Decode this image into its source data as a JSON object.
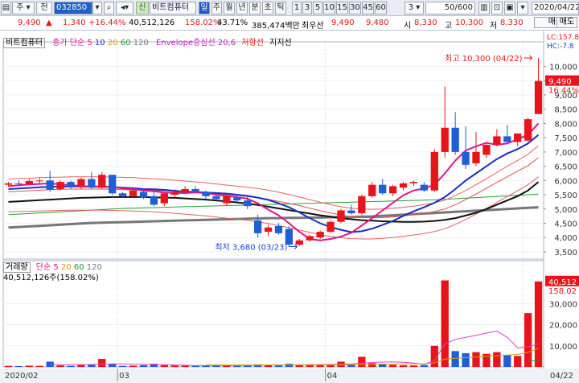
{
  "toolbar": {
    "market": "주",
    "jeon": "전",
    "code": "032850",
    "shin": "신",
    "name": "비트컴퓨터",
    "periods": [
      "일",
      "주",
      "월",
      "년",
      "분",
      "초",
      "틱"
    ],
    "minutes": [
      "1",
      "3",
      "5",
      "10",
      "15",
      "30",
      "45",
      "60"
    ],
    "interval": "3",
    "count": "50",
    "count_total": "/600",
    "date": "2020/04/22"
  },
  "infobar": {
    "price": "9,490",
    "change": "1,340",
    "change_pct": "+16.44%",
    "volume": "40,512,126",
    "vol_ratio": "158.02%",
    "turnover": "43.71%",
    "amount": "385,474백만",
    "best_ask_label": "최우선",
    "best_ask": "9,490",
    "best_bid": "9,480",
    "open_label": "시",
    "open": "8,330",
    "high_label": "고",
    "high": "10,300",
    "low_label": "저",
    "low": "8,330"
  },
  "legend": {
    "name": "비트컴퓨터",
    "ma_label": "종가 단순",
    "ma_periods": [
      "5",
      "10",
      "20",
      "60",
      "120"
    ],
    "envelope": "Envelope중심선 20,6",
    "resistance": "저항선",
    "support": "지지선",
    "lc": "LC:157.8",
    "hc": "HC:-7.8"
  },
  "vol_legend": {
    "label": "거래량",
    "ma_label": "단순",
    "ma_periods": [
      "5",
      "20",
      "60",
      "120"
    ],
    "value": "40,512,126주(158.02%)"
  },
  "annotations": {
    "high": "최고 10,300 (04/22)",
    "low": "최저 3,680 (03/23)",
    "last_price": "9,490",
    "last_pct": "16.44%",
    "last_volume": "40,512",
    "last_vol_pct": "158.02"
  },
  "x_labels": [
    "2020/02",
    "03",
    "04",
    "04/22"
  ],
  "colors": {
    "up": "#e8141c",
    "down": "#1f5fd6",
    "ma5": "#e0148c",
    "ma10": "#1b2fbf",
    "ma20": "#e05050",
    "ma60": "#111111",
    "ma120": "#777777"
  },
  "chart_data": {
    "type": "candlestick",
    "title": "비트컴퓨터",
    "ylim": [
      3300,
      10750
    ],
    "y_ticks": [
      3500,
      4000,
      4500,
      5000,
      5500,
      6000,
      6500,
      7000,
      7500,
      8000,
      8500,
      9000,
      9500,
      10000
    ],
    "y_tick_labels": [
      "3,500",
      "4,000",
      "4,500",
      "5,000",
      "5,500",
      "6,000",
      "6,500",
      "7,000",
      "7,500",
      "8,000",
      "8,500",
      "9,000",
      "9,500",
      "10,000"
    ],
    "vol_ylim": [
      0,
      45000
    ],
    "vol_ticks": [
      10000,
      20000,
      30000
    ],
    "vol_tick_labels": [
      "10,000",
      "20,000",
      "30,000"
    ],
    "candles": [
      {
        "o": 5850,
        "h": 5950,
        "l": 5780,
        "c": 5900,
        "v": 500
      },
      {
        "o": 5900,
        "h": 6000,
        "l": 5820,
        "c": 5880,
        "v": 400
      },
      {
        "o": 5880,
        "h": 6050,
        "l": 5850,
        "c": 5980,
        "v": 600
      },
      {
        "o": 5980,
        "h": 6080,
        "l": 5900,
        "c": 6000,
        "v": 500
      },
      {
        "o": 6000,
        "h": 6350,
        "l": 5600,
        "c": 5680,
        "v": 2500
      },
      {
        "o": 5700,
        "h": 6000,
        "l": 5650,
        "c": 5950,
        "v": 700
      },
      {
        "o": 5950,
        "h": 6000,
        "l": 5700,
        "c": 5800,
        "v": 500
      },
      {
        "o": 5800,
        "h": 6100,
        "l": 5700,
        "c": 6050,
        "v": 900
      },
      {
        "o": 6050,
        "h": 6300,
        "l": 5700,
        "c": 5750,
        "v": 1200
      },
      {
        "o": 5750,
        "h": 6300,
        "l": 5700,
        "c": 6200,
        "v": 3800
      },
      {
        "o": 6200,
        "h": 6200,
        "l": 5500,
        "c": 5550,
        "v": 1500
      },
      {
        "o": 5550,
        "h": 5600,
        "l": 5400,
        "c": 5450,
        "v": 500
      },
      {
        "o": 5450,
        "h": 5700,
        "l": 5400,
        "c": 5650,
        "v": 600
      },
      {
        "o": 5600,
        "h": 5700,
        "l": 5350,
        "c": 5400,
        "v": 800
      },
      {
        "o": 5450,
        "h": 5700,
        "l": 5100,
        "c": 5150,
        "v": 1500
      },
      {
        "o": 5200,
        "h": 5600,
        "l": 5100,
        "c": 5550,
        "v": 900
      },
      {
        "o": 5500,
        "h": 5700,
        "l": 5400,
        "c": 5600,
        "v": 700
      },
      {
        "o": 5600,
        "h": 5800,
        "l": 5550,
        "c": 5700,
        "v": 600
      },
      {
        "o": 5700,
        "h": 5800,
        "l": 5550,
        "c": 5600,
        "v": 500
      },
      {
        "o": 5600,
        "h": 5650,
        "l": 5350,
        "c": 5450,
        "v": 600
      },
      {
        "o": 5450,
        "h": 5550,
        "l": 5300,
        "c": 5350,
        "v": 800
      },
      {
        "o": 5200,
        "h": 5500,
        "l": 5100,
        "c": 5450,
        "v": 700
      },
      {
        "o": 5400,
        "h": 5450,
        "l": 5250,
        "c": 5300,
        "v": 500
      },
      {
        "o": 5300,
        "h": 5450,
        "l": 5000,
        "c": 5100,
        "v": 900
      },
      {
        "o": 4600,
        "h": 4800,
        "l": 4000,
        "c": 4150,
        "v": 1200
      },
      {
        "o": 4200,
        "h": 4450,
        "l": 4050,
        "c": 4350,
        "v": 800
      },
      {
        "o": 4400,
        "h": 4500,
        "l": 4100,
        "c": 4150,
        "v": 700
      },
      {
        "o": 4300,
        "h": 4400,
        "l": 3680,
        "c": 3750,
        "v": 1500
      },
      {
        "o": 3750,
        "h": 3950,
        "l": 3700,
        "c": 3900,
        "v": 900
      },
      {
        "o": 3900,
        "h": 4100,
        "l": 3850,
        "c": 4050,
        "v": 800
      },
      {
        "o": 4000,
        "h": 4250,
        "l": 3950,
        "c": 4200,
        "v": 800
      },
      {
        "o": 4200,
        "h": 4600,
        "l": 4150,
        "c": 4550,
        "v": 1300
      },
      {
        "o": 4550,
        "h": 5000,
        "l": 4500,
        "c": 4950,
        "v": 2500
      },
      {
        "o": 4950,
        "h": 5150,
        "l": 4800,
        "c": 4850,
        "v": 1200
      },
      {
        "o": 4850,
        "h": 5500,
        "l": 4800,
        "c": 5450,
        "v": 4800
      },
      {
        "o": 5450,
        "h": 5950,
        "l": 5400,
        "c": 5850,
        "v": 1800
      },
      {
        "o": 5850,
        "h": 6050,
        "l": 5500,
        "c": 5550,
        "v": 1500
      },
      {
        "o": 5550,
        "h": 5850,
        "l": 5450,
        "c": 5800,
        "v": 1000
      },
      {
        "o": 5750,
        "h": 5950,
        "l": 5650,
        "c": 5900,
        "v": 800
      },
      {
        "o": 5900,
        "h": 6000,
        "l": 5800,
        "c": 5950,
        "v": 700
      },
      {
        "o": 5850,
        "h": 5950,
        "l": 5600,
        "c": 5650,
        "v": 900
      },
      {
        "o": 5650,
        "h": 7100,
        "l": 5600,
        "c": 7000,
        "v": 10000
      },
      {
        "o": 7000,
        "h": 9300,
        "l": 6800,
        "c": 7850,
        "v": 41000
      },
      {
        "o": 7850,
        "h": 8400,
        "l": 6900,
        "c": 7000,
        "v": 7500
      },
      {
        "o": 7000,
        "h": 7900,
        "l": 6400,
        "c": 6550,
        "v": 6500
      },
      {
        "o": 6600,
        "h": 7700,
        "l": 6500,
        "c": 7000,
        "v": 7000
      },
      {
        "o": 6900,
        "h": 7300,
        "l": 6800,
        "c": 7250,
        "v": 6200
      },
      {
        "o": 7250,
        "h": 7800,
        "l": 7200,
        "c": 7550,
        "v": 7000
      },
      {
        "o": 7550,
        "h": 7950,
        "l": 7450,
        "c": 7350,
        "v": 5600
      },
      {
        "o": 7350,
        "h": 7650,
        "l": 7200,
        "c": 7650,
        "v": 5200
      },
      {
        "o": 7400,
        "h": 8200,
        "l": 7350,
        "c": 8150,
        "v": 25500
      },
      {
        "o": 8330,
        "h": 10300,
        "l": 8330,
        "c": 9490,
        "v": 40512
      }
    ],
    "ma5": [
      5800,
      5830,
      5860,
      5880,
      5900,
      5860,
      5840,
      5810,
      5780,
      5800,
      5770,
      5720,
      5700,
      5650,
      5620,
      5580,
      5560,
      5560,
      5580,
      5560,
      5500,
      5460,
      5420,
      5360,
      5200,
      4980,
      4780,
      4500,
      4200,
      3950,
      3900,
      3950,
      4030,
      4170,
      4420,
      4680,
      4950,
      5220,
      5480,
      5650,
      5720,
      5850,
      6250,
      6700,
      7050,
      7200,
      7320,
      7250,
      7300,
      7450,
      7600,
      8000
    ],
    "ma10": [
      5700,
      5720,
      5740,
      5760,
      5780,
      5790,
      5790,
      5790,
      5780,
      5780,
      5770,
      5750,
      5730,
      5700,
      5690,
      5670,
      5640,
      5610,
      5590,
      5580,
      5560,
      5540,
      5500,
      5460,
      5400,
      5320,
      5200,
      5060,
      4880,
      4680,
      4500,
      4360,
      4270,
      4190,
      4220,
      4310,
      4440,
      4580,
      4760,
      4920,
      5060,
      5220,
      5420,
      5700,
      6000,
      6250,
      6500,
      6750,
      6950,
      7100,
      7300,
      7600
    ],
    "ma20": [
      5600,
      5620,
      5640,
      5660,
      5680,
      5690,
      5700,
      5700,
      5700,
      5700,
      5690,
      5680,
      5670,
      5660,
      5650,
      5640,
      5620,
      5600,
      5580,
      5560,
      5540,
      5510,
      5480,
      5440,
      5400,
      5340,
      5270,
      5200,
      5120,
      5030,
      4940,
      4860,
      4790,
      4730,
      4700,
      4690,
      4700,
      4720,
      4760,
      4800,
      4850,
      4910,
      5000,
      5150,
      5330,
      5520,
      5730,
      5930,
      6130,
      6330,
      6520,
      6800
    ],
    "ma60": [
      5250,
      5270,
      5290,
      5310,
      5330,
      5350,
      5370,
      5390,
      5400,
      5410,
      5420,
      5420,
      5420,
      5420,
      5410,
      5400,
      5390,
      5370,
      5350,
      5330,
      5300,
      5270,
      5230,
      5190,
      5140,
      5080,
      5020,
      4960,
      4900,
      4840,
      4780,
      4730,
      4680,
      4640,
      4610,
      4590,
      4570,
      4560,
      4550,
      4550,
      4560,
      4580,
      4620,
      4680,
      4770,
      4870,
      5000,
      5150,
      5300,
      5450,
      5650,
      5950
    ],
    "ma120": [
      4350,
      4370,
      4390,
      4410,
      4430,
      4450,
      4470,
      4490,
      4510,
      4520,
      4530,
      4540,
      4550,
      4560,
      4570,
      4580,
      4590,
      4600,
      4610,
      4620,
      4630,
      4640,
      4650,
      4660,
      4670,
      4680,
      4680,
      4690,
      4690,
      4700,
      4700,
      4710,
      4710,
      4720,
      4730,
      4740,
      4760,
      4780,
      4800,
      4820,
      4840,
      4860,
      4880,
      4900,
      4920,
      4940,
      4960,
      4980,
      5000,
      5020,
      5040,
      5060
    ],
    "env_upper": [
      6050,
      6070,
      6080,
      6100,
      6110,
      6120,
      6130,
      6130,
      6130,
      6130,
      6120,
      6110,
      6100,
      6080,
      6060,
      6040,
      6010,
      5980,
      5950,
      5920,
      5880,
      5840,
      5800,
      5760,
      5720,
      5660,
      5590,
      5510,
      5420,
      5330,
      5240,
      5150,
      5080,
      5030,
      5000,
      4990,
      5000,
      5030,
      5060,
      5100,
      5150,
      5220,
      5310,
      5470,
      5650,
      5850,
      6060,
      6280,
      6500,
      6700,
      6920,
      7220
    ],
    "env_lower": [
      4900,
      4910,
      4920,
      4930,
      4940,
      4950,
      4960,
      4960,
      4960,
      4960,
      4950,
      4940,
      4930,
      4920,
      4900,
      4880,
      4850,
      4820,
      4790,
      4760,
      4720,
      4680,
      4640,
      4600,
      4550,
      4490,
      4420,
      4340,
      4260,
      4180,
      4100,
      4040,
      3990,
      3960,
      3950,
      3950,
      3970,
      4000,
      4040,
      4090,
      4140,
      4210,
      4310,
      4460,
      4630,
      4820,
      5020,
      5230,
      5440,
      5640,
      5850,
      6130
    ],
    "support": [
      4800,
      4820,
      4840,
      4860,
      4880,
      4900,
      4920,
      4940,
      4960,
      4980,
      5000,
      5020,
      5030,
      5040,
      5050,
      5060,
      5070,
      5080,
      5090,
      5100,
      5110,
      5120,
      5130,
      5140,
      5150,
      5160,
      5170,
      5180,
      5190,
      5200,
      5210,
      5220,
      5230,
      5240,
      5250,
      5260,
      5270,
      5280,
      5290,
      5300,
      5310,
      5320,
      5340,
      5360,
      5380,
      5400,
      5420,
      5440,
      5460,
      5480,
      5500,
      5520
    ],
    "vol_ma5": [
      0,
      0,
      0,
      0,
      900,
      1000,
      1000,
      1100,
      1150,
      1300,
      1400,
      1400,
      1300,
      1200,
      1100,
      1000,
      900,
      800,
      700,
      700,
      700,
      650,
      650,
      700,
      800,
      850,
      900,
      950,
      1000,
      1050,
      1100,
      1150,
      1250,
      1400,
      1800,
      2100,
      2300,
      2400,
      2200,
      1800,
      1300,
      2900,
      11000,
      13000,
      14000,
      15000,
      16000,
      17000,
      14000,
      9000,
      9500,
      11000
    ],
    "vol_ma20": [
      0,
      0,
      0,
      0,
      0,
      0,
      0,
      0,
      0,
      0,
      0,
      0,
      0,
      0,
      0,
      0,
      0,
      0,
      0,
      900,
      900,
      900,
      900,
      900,
      900,
      900,
      900,
      900,
      900,
      900,
      950,
      950,
      950,
      1000,
      1150,
      1250,
      1300,
      1350,
      1400,
      1450,
      1500,
      1900,
      3700,
      4100,
      4400,
      4700,
      5000,
      5300,
      5600,
      5900,
      6900,
      8800
    ],
    "vol_ma60": [
      0,
      0,
      0,
      0,
      0,
      0,
      0,
      0,
      0,
      0,
      0,
      0,
      0,
      0,
      0,
      0,
      0,
      0,
      0,
      0,
      0,
      0,
      0,
      0,
      0,
      0,
      0,
      0,
      0,
      0,
      0,
      0,
      0,
      0,
      0,
      0,
      0,
      0,
      0,
      0,
      0,
      0,
      0,
      0,
      0,
      0,
      0,
      0,
      0,
      0,
      2600,
      3200
    ]
  }
}
